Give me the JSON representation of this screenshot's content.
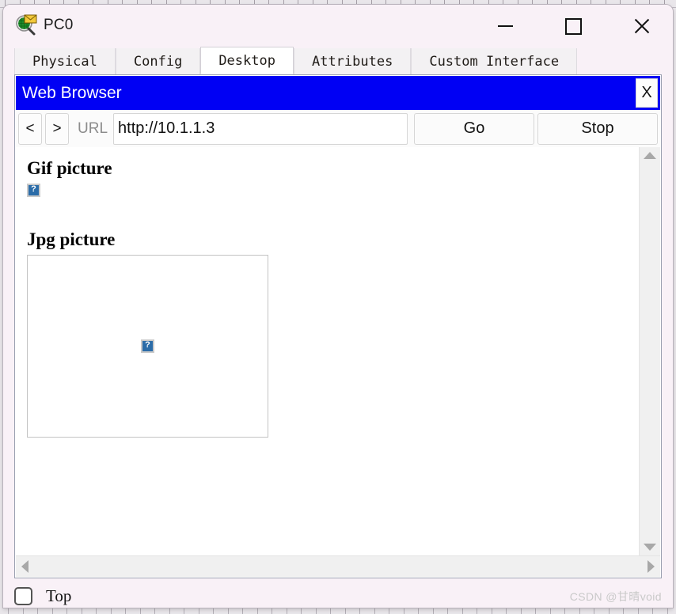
{
  "window": {
    "title": "PC0",
    "app_icon": "packet-tracer-pc-icon",
    "controls": {
      "minimize": "—",
      "maximize": "□",
      "close": "✕"
    }
  },
  "tabs": [
    {
      "label": "Physical",
      "active": false
    },
    {
      "label": "Config",
      "active": false
    },
    {
      "label": "Desktop",
      "active": true
    },
    {
      "label": "Attributes",
      "active": false
    },
    {
      "label": "Custom Interface",
      "active": false
    }
  ],
  "browser": {
    "title": "Web Browser",
    "close_label": "X",
    "titlebar_color": "#0000f4",
    "toolbar": {
      "back_label": "<",
      "forward_label": ">",
      "url_label": "URL",
      "url_value": "http://10.1.1.3",
      "url_placeholder": "http://",
      "go_label": "Go",
      "stop_label": "Stop"
    },
    "page": {
      "gif_heading": "Gif picture",
      "jpg_heading": "Jpg picture",
      "gif_image_alt": "?",
      "jpg_image_alt": "?"
    },
    "scrollbars": {
      "up_arrow": "▲",
      "down_arrow": "▼",
      "left_arrow": "◀",
      "right_arrow": "▶"
    }
  },
  "bottom": {
    "top_checkbox_label": "Top",
    "top_checkbox_checked": false,
    "watermark": "CSDN @甘晴void"
  }
}
